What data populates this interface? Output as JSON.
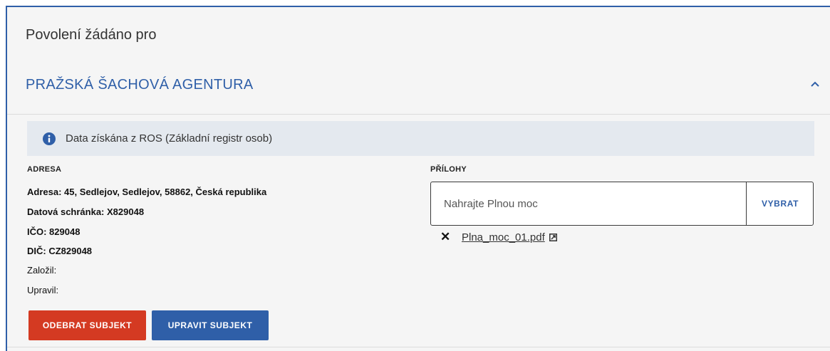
{
  "section": {
    "title": "Povolení žádáno pro"
  },
  "subject": {
    "name": "PRAŽSKÁ ŠACHOVÁ AGENTURA",
    "expanded": true
  },
  "info": {
    "text": "Data získána z ROS (Základní registr osob)",
    "icon": "info-icon"
  },
  "address": {
    "label": "ADRESA",
    "lines": [
      "Adresa: 45, Sedlejov, Sedlejov, 58862, Česká republika",
      "Datová schránka: X829048",
      "IČO: 829048",
      "DIČ: CZ829048",
      "Založil:",
      "Upravil:"
    ]
  },
  "attachments": {
    "label": "PŘÍLOHY",
    "placeholder": "Nahrajte Plnou moc",
    "select_label": "VYBRAT",
    "files": [
      {
        "name": "Plna_moc_01.pdf"
      }
    ]
  },
  "actions": {
    "remove_label": "ODEBRAT SUBJEKT",
    "edit_label": "UPRAVIT SUBJEKT"
  },
  "colors": {
    "accent": "#2f5fa8",
    "danger": "#d43a22",
    "banner": "#e4e9ef",
    "panel": "#f5f5f5"
  }
}
